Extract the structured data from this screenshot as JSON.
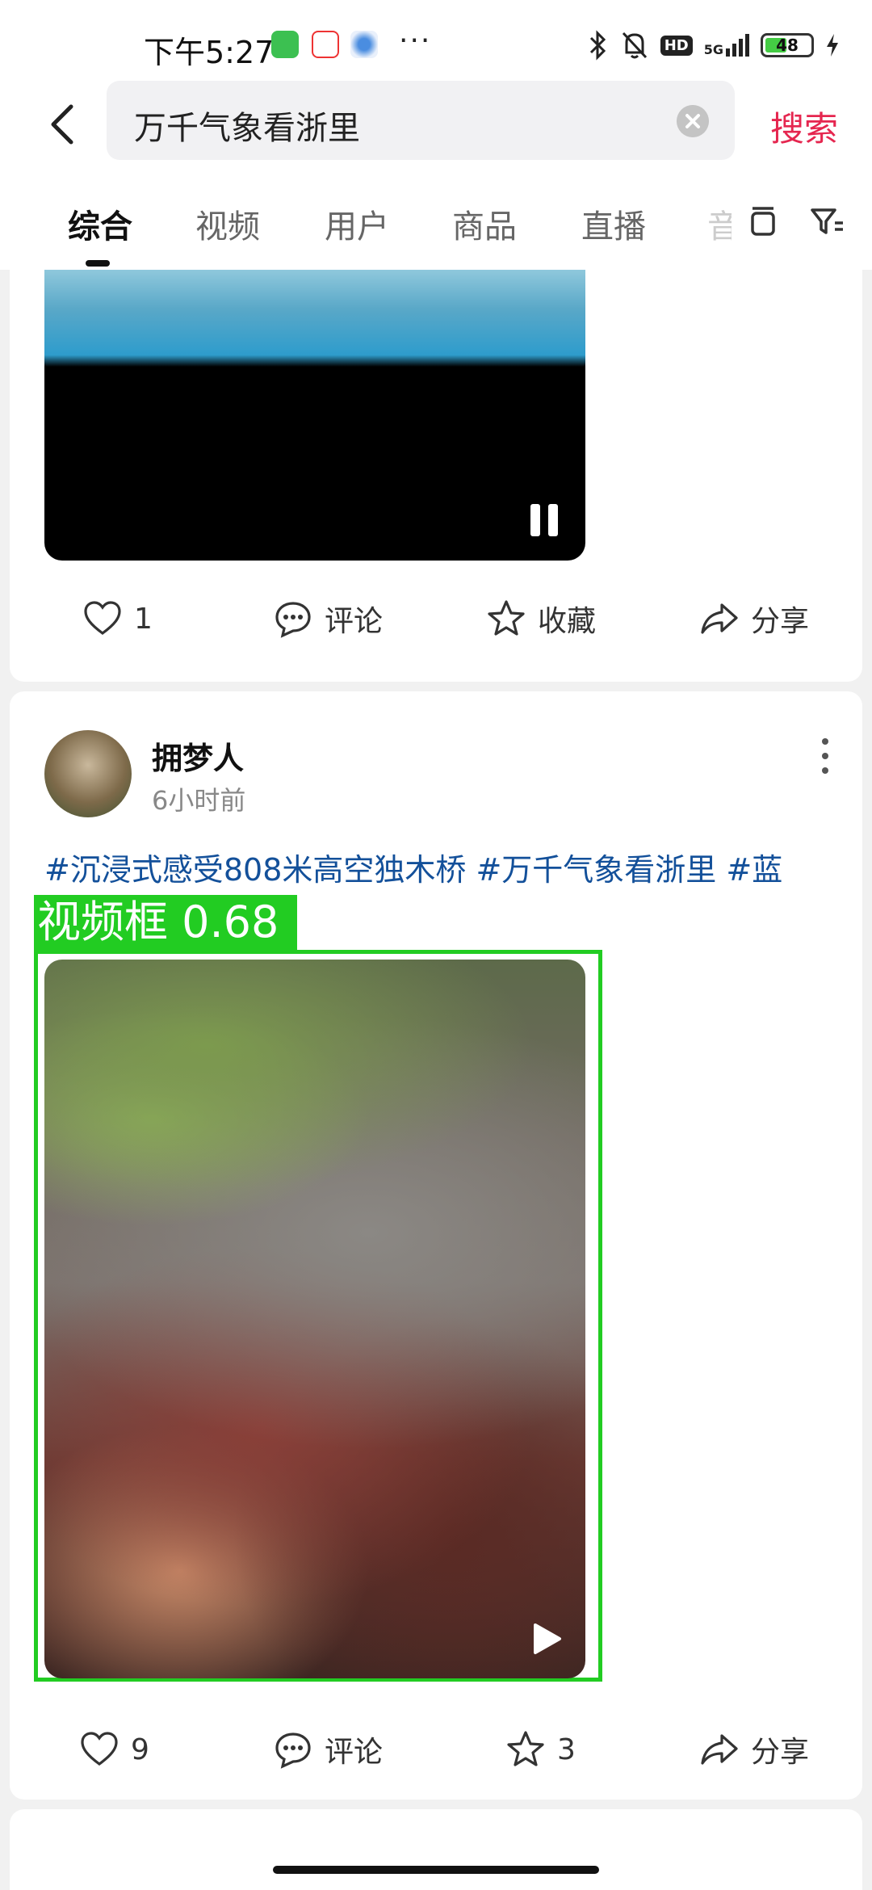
{
  "status_bar": {
    "time": "下午5:27",
    "icons": [
      "wechat-icon",
      "app58-icon",
      "cloud-icon",
      "bluetooth-icon",
      "bell-off-icon",
      "hd-icon",
      "signal-5g-icon",
      "charging-icon"
    ],
    "more": "···",
    "hd": "HD",
    "network": "5G",
    "battery": "48",
    "battery_level": 0.48
  },
  "header": {
    "query": "万千气象看浙里",
    "search_label": "搜索"
  },
  "tabs": [
    {
      "label": "综合",
      "active": true
    },
    {
      "label": "视频"
    },
    {
      "label": "用户"
    },
    {
      "label": "商品"
    },
    {
      "label": "直播"
    },
    {
      "label": "音"
    }
  ],
  "post1": {
    "actions": {
      "like_count": "1",
      "comment_label": "评论",
      "favorite_label": "收藏",
      "share_label": "分享"
    }
  },
  "post2": {
    "username": "拥梦人",
    "time": "6小时前",
    "caption": "#沉浸式感受808米高空独木桥 #万千气象看浙里 #蓝",
    "detection_label": "视频框 0.68",
    "actions": {
      "like_count": "9",
      "comment_label": "评论",
      "favorite_count": "3",
      "share_label": "分享"
    }
  },
  "colors": {
    "accent": "#e5264f",
    "hashtag": "#13509a",
    "detection": "#22cc22"
  }
}
